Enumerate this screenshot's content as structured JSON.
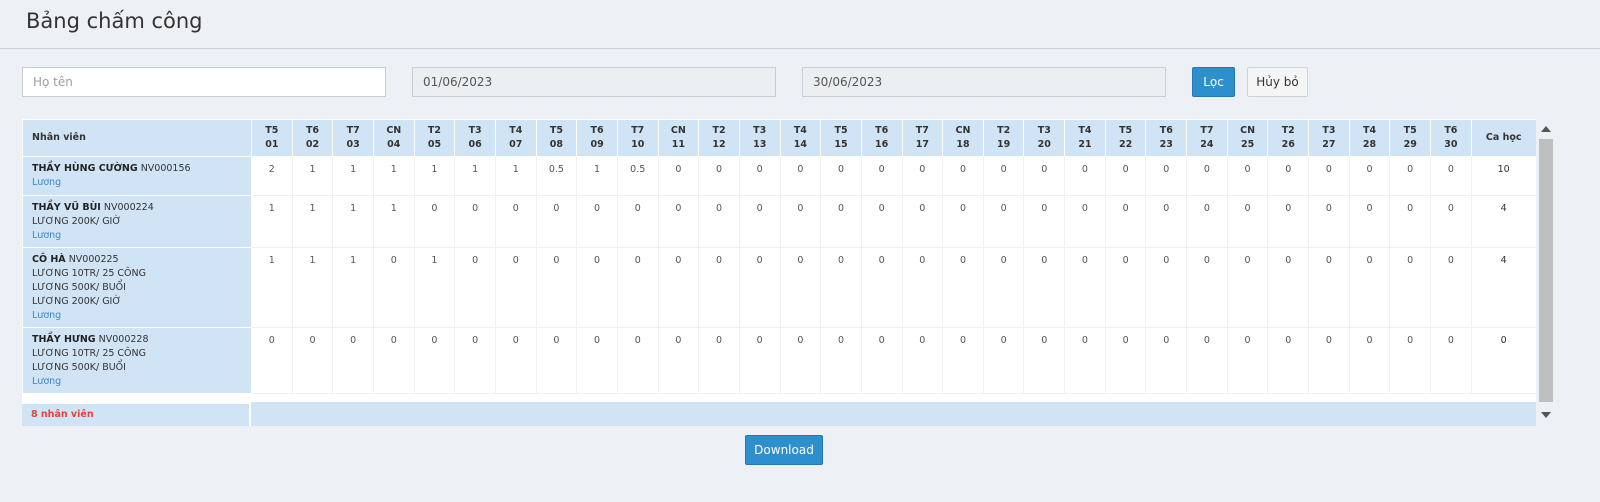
{
  "header": {
    "title": "Bảng chấm công"
  },
  "filters": {
    "name_placeholder": "Họ tên",
    "date_from": "01/06/2023",
    "date_to": "30/06/2023",
    "filter_label": "Lọc",
    "cancel_label": "Hủy bỏ"
  },
  "table": {
    "employee_header": "Nhân viên",
    "total_header": "Ca học",
    "days": [
      {
        "dow": "T5",
        "day": "01"
      },
      {
        "dow": "T6",
        "day": "02"
      },
      {
        "dow": "T7",
        "day": "03"
      },
      {
        "dow": "CN",
        "day": "04"
      },
      {
        "dow": "T2",
        "day": "05"
      },
      {
        "dow": "T3",
        "day": "06"
      },
      {
        "dow": "T4",
        "day": "07"
      },
      {
        "dow": "T5",
        "day": "08"
      },
      {
        "dow": "T6",
        "day": "09"
      },
      {
        "dow": "T7",
        "day": "10"
      },
      {
        "dow": "CN",
        "day": "11"
      },
      {
        "dow": "T2",
        "day": "12"
      },
      {
        "dow": "T3",
        "day": "13"
      },
      {
        "dow": "T4",
        "day": "14"
      },
      {
        "dow": "T5",
        "day": "15"
      },
      {
        "dow": "T6",
        "day": "16"
      },
      {
        "dow": "T7",
        "day": "17"
      },
      {
        "dow": "CN",
        "day": "18"
      },
      {
        "dow": "T2",
        "day": "19"
      },
      {
        "dow": "T3",
        "day": "20"
      },
      {
        "dow": "T4",
        "day": "21"
      },
      {
        "dow": "T5",
        "day": "22"
      },
      {
        "dow": "T6",
        "day": "23"
      },
      {
        "dow": "T7",
        "day": "24"
      },
      {
        "dow": "CN",
        "day": "25"
      },
      {
        "dow": "T2",
        "day": "26"
      },
      {
        "dow": "T3",
        "day": "27"
      },
      {
        "dow": "T4",
        "day": "28"
      },
      {
        "dow": "T5",
        "day": "29"
      },
      {
        "dow": "T6",
        "day": "30"
      }
    ],
    "rows": [
      {
        "name": "THẦY HÙNG CƯỜNG",
        "code": "NV000156",
        "salaries": [],
        "link": "Lương",
        "values": [
          "2",
          "1",
          "1",
          "1",
          "1",
          "1",
          "1",
          "0.5",
          "1",
          "0.5",
          "0",
          "0",
          "0",
          "0",
          "0",
          "0",
          "0",
          "0",
          "0",
          "0",
          "0",
          "0",
          "0",
          "0",
          "0",
          "0",
          "0",
          "0",
          "0",
          "0"
        ],
        "red_days": [
          5,
          6
        ],
        "total": "10"
      },
      {
        "name": "THẦY VŨ BÙI",
        "code": "NV000224",
        "salaries": [
          "LƯƠNG 200K/ GIỜ"
        ],
        "link": "Lương",
        "values": [
          "1",
          "1",
          "1",
          "1",
          "0",
          "0",
          "0",
          "0",
          "0",
          "0",
          "0",
          "0",
          "0",
          "0",
          "0",
          "0",
          "0",
          "0",
          "0",
          "0",
          "0",
          "0",
          "0",
          "0",
          "0",
          "0",
          "0",
          "0",
          "0",
          "0"
        ],
        "red_days": [],
        "total": "4"
      },
      {
        "name": "CÔ HÀ",
        "code": "NV000225",
        "salaries": [
          "LƯƠNG 10TR/ 25 CÔNG",
          "LƯƠNG 500K/ BUỔI",
          "LƯƠNG 200K/ GIỜ"
        ],
        "link": "Lương",
        "values": [
          "1",
          "1",
          "1",
          "0",
          "1",
          "0",
          "0",
          "0",
          "0",
          "0",
          "0",
          "0",
          "0",
          "0",
          "0",
          "0",
          "0",
          "0",
          "0",
          "0",
          "0",
          "0",
          "0",
          "0",
          "0",
          "0",
          "0",
          "0",
          "0",
          "0"
        ],
        "red_days": [],
        "total": "4"
      },
      {
        "name": "THẦY HƯNG",
        "code": "NV000228",
        "salaries": [
          "LƯƠNG 10TR/ 25 CÔNG",
          "LƯƠNG 500K/ BUỔI"
        ],
        "link": "Lương",
        "values": [
          "0",
          "0",
          "0",
          "0",
          "0",
          "0",
          "0",
          "0",
          "0",
          "0",
          "0",
          "0",
          "0",
          "0",
          "0",
          "0",
          "0",
          "0",
          "0",
          "0",
          "0",
          "0",
          "0",
          "0",
          "0",
          "0",
          "0",
          "0",
          "0",
          "0"
        ],
        "red_days": [],
        "total": "0"
      }
    ],
    "footer_count": "8 nhân viên"
  },
  "download_label": "Download",
  "colors": {
    "primary": "#2e8fcf",
    "header_bg": "#d1e4f6",
    "count_text": "#e0443a",
    "link": "#3f86c8"
  }
}
